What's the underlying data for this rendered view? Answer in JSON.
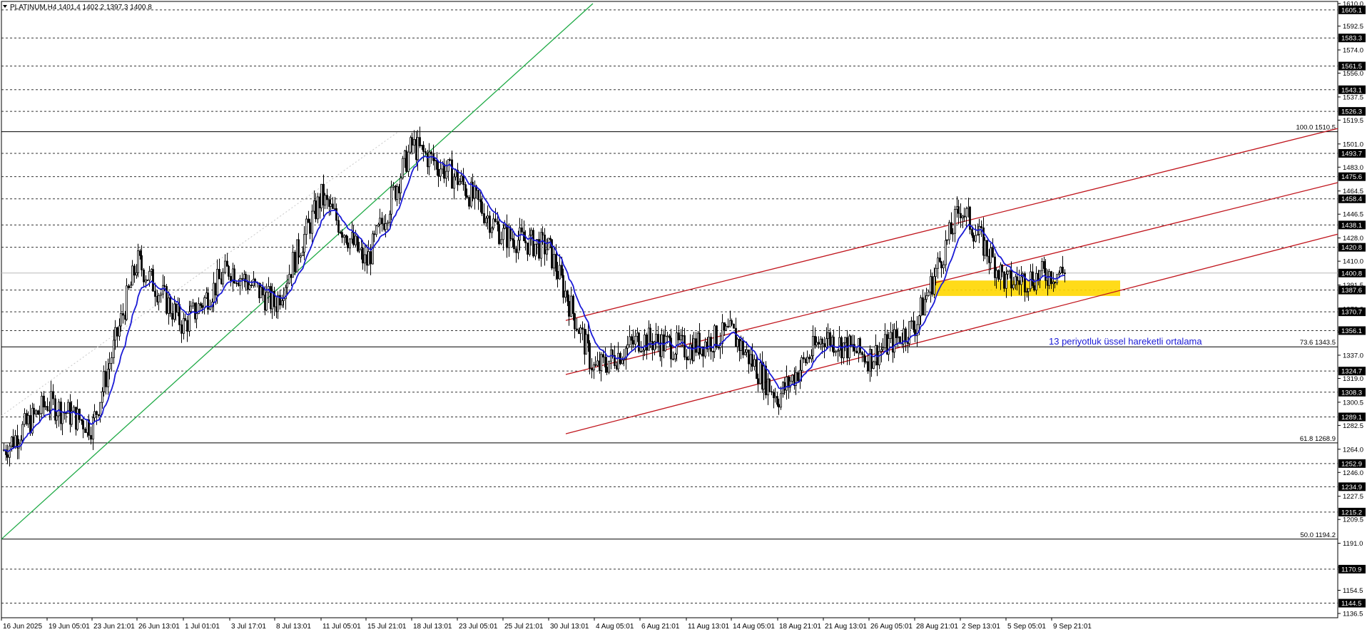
{
  "header": {
    "text": "PLATINUM,H4  1401.4 1402.2 1397.3 1400.8"
  },
  "chart_data": {
    "type": "candlestick",
    "symbol": "PLATINUM",
    "timeframe": "H4",
    "ohlc_current": {
      "open": 1401.4,
      "high": 1402.2,
      "low": 1397.3,
      "close": 1400.8
    },
    "ylim": [
      1136.5,
      1610.0
    ],
    "y_ticks": [
      1610.0,
      1592.5,
      1574.0,
      1556.0,
      1537.5,
      1519.5,
      1501.0,
      1483.0,
      1464.5,
      1446.5,
      1428.0,
      1410.0,
      1391.5,
      1373.0,
      1355.0,
      1337.0,
      1319.0,
      1300.5,
      1282.5,
      1264.0,
      1246.0,
      1227.5,
      1209.5,
      1191.0,
      1172.5,
      1154.5,
      1136.5
    ],
    "x_labels": [
      "16 Jun 2025",
      "19 Jun 05:01",
      "23 Jun 21:01",
      "26 Jun 13:01",
      "1 Jul 01:01",
      "3 Jul 17:01",
      "8 Jul 13:01",
      "11 Jul 05:01",
      "15 Jul 21:01",
      "18 Jul 13:01",
      "23 Jul 05:01",
      "25 Jul 21:01",
      "30 Jul 13:01",
      "4 Aug 05:01",
      "6 Aug 21:01",
      "11 Aug 13:01",
      "14 Aug 05:01",
      "18 Aug 21:01",
      "21 Aug 13:01",
      "26 Aug 05:01",
      "28 Aug 21:01",
      "2 Sep 13:01",
      "5 Sep 05:01",
      "9 Sep 21:01"
    ],
    "horizontal_levels": [
      1605.1,
      1583.3,
      1561.5,
      1543.1,
      1526.3,
      1493.7,
      1475.6,
      1458.4,
      1438.1,
      1420.8,
      1387.6,
      1370.7,
      1356.1,
      1324.7,
      1308.3,
      1289.1,
      1252.9,
      1234.9,
      1215.2,
      1170.9,
      1144.5
    ],
    "current_price": 1400.8,
    "fibonacci": [
      {
        "label": "100.0 1510.5",
        "value": 1510.5
      },
      {
        "label": "73.6 1343.5",
        "value": 1343.5
      },
      {
        "label": "61.8 1268.9",
        "value": 1268.9
      },
      {
        "label": "50.0 1194.2",
        "value": 1194.2
      }
    ],
    "support_zone": {
      "low": 1383.0,
      "high": 1395.0,
      "from": "28 Aug 21:01",
      "to": "9 Sep 21:01",
      "color": "#ffd700"
    },
    "trendlines": [
      {
        "color": "#1faa46",
        "from": {
          "x": "16 Jun 2025",
          "y": 1194.2
        },
        "to": {
          "x": "23 Jul 05:01",
          "y": 1610.0
        }
      },
      {
        "color": "#c0141c",
        "from": {
          "x": "30 Jul 13:01",
          "y": 1364.0
        },
        "to": {
          "x": "9 Sep 21:01",
          "y": 1505.0
        }
      },
      {
        "color": "#c0141c",
        "from": {
          "x": "30 Jul 13:01",
          "y": 1322.0
        },
        "to": {
          "x": "9 Sep 21:01",
          "y": 1463.0
        }
      },
      {
        "color": "#c0141c",
        "from": {
          "x": "30 Jul 13:01",
          "y": 1276.0
        },
        "to": {
          "x": "9 Sep 21:01",
          "y": 1423.0
        }
      }
    ],
    "indicator": {
      "name": "13 periyotluk üssel hareketli ortalama",
      "color": "#1a1ad6"
    },
    "anchors": [
      {
        "x": "16 Jun 2025",
        "y": 1262.0
      },
      {
        "x": "19 Jun 05:01",
        "y": 1300.0
      },
      {
        "x": "23 Jun 21:01",
        "y": 1282.0
      },
      {
        "x": "26 Jun 13:01",
        "y": 1410.0
      },
      {
        "x": "1 Jul 01:01",
        "y": 1360.0
      },
      {
        "x": "3 Jul 17:01",
        "y": 1405.0
      },
      {
        "x": "8 Jul 13:01",
        "y": 1376.0
      },
      {
        "x": "11 Jul 05:01",
        "y": 1460.0
      },
      {
        "x": "15 Jul 21:01",
        "y": 1408.0
      },
      {
        "x": "18 Jul 13:01",
        "y": 1500.0
      },
      {
        "x": "23 Jul 05:01",
        "y": 1474.0
      },
      {
        "x": "25 Jul 21:01",
        "y": 1430.0
      },
      {
        "x": "30 Jul 13:01",
        "y": 1420.0
      },
      {
        "x": "4 Aug 05:01",
        "y": 1325.0
      },
      {
        "x": "6 Aug 21:01",
        "y": 1350.0
      },
      {
        "x": "11 Aug 13:01",
        "y": 1342.0
      },
      {
        "x": "14 Aug 05:01",
        "y": 1354.0
      },
      {
        "x": "18 Aug 21:01",
        "y": 1304.0
      },
      {
        "x": "21 Aug 13:01",
        "y": 1352.0
      },
      {
        "x": "26 Aug 05:01",
        "y": 1335.0
      },
      {
        "x": "28 Aug 21:01",
        "y": 1360.0
      },
      {
        "x": "2 Sep 13:01",
        "y": 1452.0
      },
      {
        "x": "5 Sep 05:01",
        "y": 1393.0
      },
      {
        "x": "9 Sep 21:01",
        "y": 1400.8
      }
    ]
  }
}
